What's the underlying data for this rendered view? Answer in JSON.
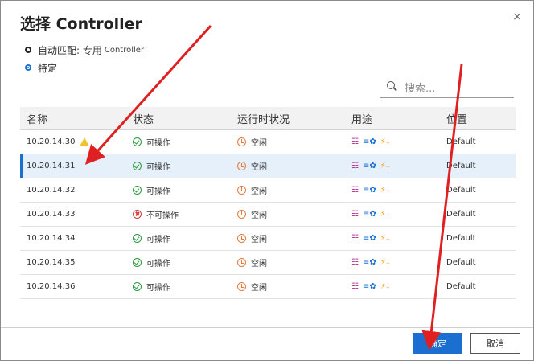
{
  "dialog": {
    "title": "选择 Controller",
    "close_glyph": "×"
  },
  "options": {
    "auto": {
      "label": "自动匹配: 专用",
      "suffix": "Controller",
      "selected": false
    },
    "specific": {
      "label": "特定",
      "selected": true
    }
  },
  "search": {
    "placeholder": "搜索..."
  },
  "table": {
    "headers": [
      "名称",
      "状态",
      "运行时状况",
      "用途",
      "位置"
    ],
    "rows": [
      {
        "name": "10.20.14.30",
        "warning": true,
        "status": "可操作",
        "status_type": "ok",
        "runtime": "空闲",
        "location": "Default"
      },
      {
        "name": "10.20.14.31",
        "warning": false,
        "status": "可操作",
        "status_type": "ok",
        "runtime": "空闲",
        "location": "Default",
        "selected": true
      },
      {
        "name": "10.20.14.32",
        "warning": false,
        "status": "可操作",
        "status_type": "ok",
        "runtime": "空闲",
        "location": "Default"
      },
      {
        "name": "10.20.14.33",
        "warning": false,
        "status": "不可操作",
        "status_type": "error",
        "runtime": "空闲",
        "location": "Default"
      },
      {
        "name": "10.20.14.34",
        "warning": false,
        "status": "可操作",
        "status_type": "ok",
        "runtime": "空闲",
        "location": "Default"
      },
      {
        "name": "10.20.14.35",
        "warning": false,
        "status": "可操作",
        "status_type": "ok",
        "runtime": "空闲",
        "location": "Default"
      },
      {
        "name": "10.20.14.36",
        "warning": false,
        "status": "可操作",
        "status_type": "ok",
        "runtime": "空闲",
        "location": "Default"
      }
    ],
    "usage_icons": {
      "sliders": "☷",
      "gear": "≡✿",
      "bolt": "⚡₊"
    }
  },
  "footer": {
    "ok_label": "确定",
    "cancel_label": "取消"
  },
  "colors": {
    "accent": "#1a6fd1",
    "ok": "#2c9a3c",
    "error": "#d03a3a",
    "idle": "#e77a3a",
    "warning": "#f2c230",
    "annotation_arrow": "#e02020"
  }
}
